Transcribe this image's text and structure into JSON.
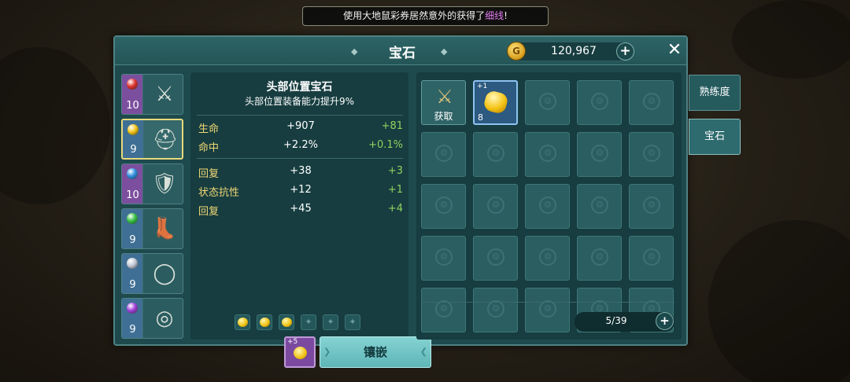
{
  "toast": {
    "prefix": "使用大地鼠彩券居然意外的获得了",
    "item": "细线",
    "suffix": "!"
  },
  "header": {
    "title": "宝石",
    "coin_symbol": "G",
    "coins": "120,967",
    "plus": "+",
    "close": "✕"
  },
  "equipment": [
    {
      "name": "weapon",
      "level": "10",
      "gem_color": "#e0322c",
      "frame": "purple",
      "icon": "sword-icon",
      "glyph": "⚔"
    },
    {
      "name": "helmet",
      "level": "9",
      "gem_color": "#f2c417",
      "frame": "blue",
      "icon": "helmet-icon",
      "glyph": "⛑"
    },
    {
      "name": "armor",
      "level": "10",
      "gem_color": "#2f8fe0",
      "frame": "purple",
      "icon": "armor-icon",
      "glyph": "🛡"
    },
    {
      "name": "boots",
      "level": "9",
      "gem_color": "#36c243",
      "frame": "blue",
      "icon": "boots-icon",
      "glyph": "👢"
    },
    {
      "name": "necklace",
      "level": "9",
      "gem_color": "#c3c9d6",
      "frame": "blue",
      "icon": "necklace-icon",
      "glyph": "◯"
    },
    {
      "name": "ring",
      "level": "9",
      "gem_color": "#a23fd9",
      "frame": "blue",
      "icon": "ring-icon",
      "glyph": "◎"
    }
  ],
  "stats": {
    "title": "头部位置宝石",
    "subtitle": "头部位置装备能力提升9%",
    "rows": [
      {
        "name": "生命",
        "current": "+907",
        "bonus": "+81"
      },
      {
        "name": "命中",
        "current": "+2.2%",
        "bonus": "+0.1%"
      },
      {
        "name": "回复",
        "current": "+38",
        "bonus": "+3"
      },
      {
        "name": "状态抗性",
        "current": "+12",
        "bonus": "+1"
      },
      {
        "name": "回复",
        "current": "+45",
        "bonus": "+4"
      }
    ]
  },
  "gem_slots": {
    "filled": 3,
    "empty": 3,
    "gem_color": "#f2c417"
  },
  "selected_gem": {
    "plus": "+5",
    "color": "#f2c417"
  },
  "inlay_button": "镶嵌",
  "inventory": {
    "get_label": "获取",
    "gem_item": {
      "plus": "+1",
      "count": "8"
    },
    "capacity": "5/39",
    "plus": "+"
  },
  "side_tabs": [
    {
      "label": "熟练度",
      "active": false
    },
    {
      "label": "宝石",
      "active": true
    }
  ]
}
